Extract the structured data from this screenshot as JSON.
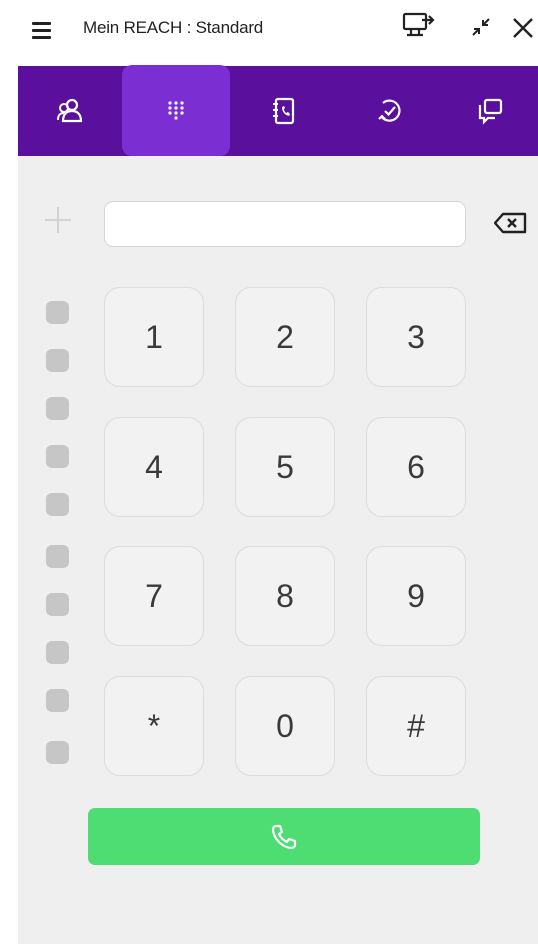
{
  "window": {
    "title": "Mein REACH : Standard",
    "icons": [
      "menu-icon",
      "screen-share-icon",
      "minimize-icon",
      "close-icon"
    ]
  },
  "nav": {
    "tabs": [
      {
        "name": "contacts",
        "icon": "contacts-icon",
        "active": false
      },
      {
        "name": "dialpad",
        "icon": "dialpad-icon",
        "active": true
      },
      {
        "name": "phonebook",
        "icon": "phonebook-icon",
        "active": false
      },
      {
        "name": "history",
        "icon": "history-icon",
        "active": false
      },
      {
        "name": "conversations",
        "icon": "chat-icon",
        "active": false
      }
    ],
    "color": "#5a109d",
    "active_color": "#7b2fd3"
  },
  "dialer": {
    "input_value": "",
    "input_placeholder": "",
    "keys": [
      "1",
      "2",
      "3",
      "4",
      "5",
      "6",
      "7",
      "8",
      "9",
      "*",
      "0",
      "#"
    ],
    "speed_dial_count": 10,
    "call_color": "#4ddd72"
  }
}
